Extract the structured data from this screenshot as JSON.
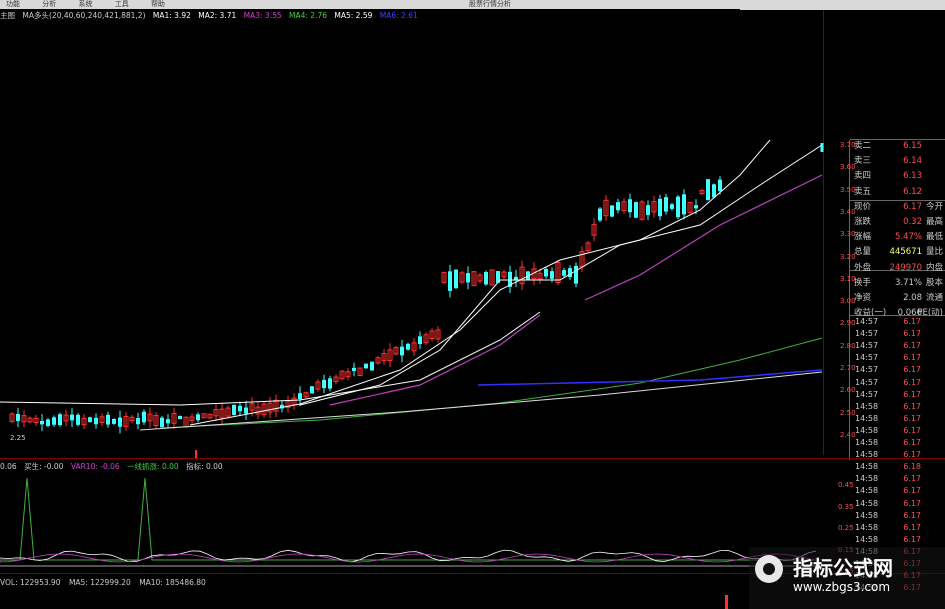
{
  "menubar": {
    "items": [
      "功能",
      "分析",
      "系统",
      "工具",
      "帮助"
    ],
    "right_title": "股票行情分析"
  },
  "indicator_line": {
    "name": "主图",
    "formula": "MA多头(20,40,60,240,421,881,2)",
    "items": [
      {
        "label": "MA1: 3.92",
        "color": "#ffffff"
      },
      {
        "label": "MA2: 3.71",
        "color": "#ffffff"
      },
      {
        "label": "MA3: 3.55",
        "color": "#d040d0"
      },
      {
        "label": "MA4: 2.76",
        "color": "#40d040"
      },
      {
        "label": "MA5: 2.59",
        "color": "#ffffff"
      },
      {
        "label": "MA6: 2.61",
        "color": "#4040ff"
      }
    ]
  },
  "price_axis": [
    "3.70",
    "3.60",
    "3.50",
    "3.40",
    "3.30",
    "3.20",
    "3.10",
    "3.00",
    "2.90",
    "2.80",
    "2.70",
    "2.60",
    "2.50",
    "2.40"
  ],
  "low_marker": "2.25",
  "quote": {
    "rows": [
      {
        "label": "卖二",
        "value": "6.15",
        "value_color": "#ff5050",
        "label2": "",
        "val2": ""
      },
      {
        "label": "卖三",
        "value": "6.14",
        "value_color": "#ff5050",
        "label2": "",
        "val2": ""
      },
      {
        "label": "卖四",
        "value": "6.13",
        "value_color": "#ff5050",
        "label2": "",
        "val2": ""
      },
      {
        "label": "卖五",
        "value": "6.12",
        "value_color": "#ff5050",
        "label2": "",
        "val2": ""
      },
      {
        "label": "现价",
        "value": "6.17",
        "value_color": "#ff5050",
        "label2": "今开",
        "val2": ""
      },
      {
        "label": "涨跌",
        "value": "0.32",
        "value_color": "#ff5050",
        "label2": "最高",
        "val2": ""
      },
      {
        "label": "涨幅",
        "value": "5.47%",
        "value_color": "#ff5050",
        "label2": "最低",
        "val2": ""
      },
      {
        "label": "总量",
        "value": "445671",
        "value_color": "#ffff66",
        "label2": "量比",
        "val2": ""
      },
      {
        "label": "外盘",
        "value": "249970",
        "value_color": "#ff5050",
        "label2": "内盘",
        "val2": ""
      },
      {
        "label": "换手",
        "value": "3.71%",
        "value_color": "#cccccc",
        "label2": "股本",
        "val2": ""
      },
      {
        "label": "净资",
        "value": "2.08",
        "value_color": "#cccccc",
        "label2": "流通",
        "val2": ""
      },
      {
        "label": "收益(一)",
        "value": "0.066",
        "value_color": "#cccccc",
        "label2": "PE(动)",
        "val2": ""
      }
    ]
  },
  "ticks": [
    {
      "time": "14:57",
      "price": "6.17"
    },
    {
      "time": "14:57",
      "price": "6.17"
    },
    {
      "time": "14:57",
      "price": "6.17"
    },
    {
      "time": "14:57",
      "price": "6.17"
    },
    {
      "time": "14:57",
      "price": "6.17"
    },
    {
      "time": "14:57",
      "price": "6.17"
    },
    {
      "time": "14:57",
      "price": "6.17"
    },
    {
      "time": "14:58",
      "price": "6.17"
    },
    {
      "time": "14:58",
      "price": "6.17"
    },
    {
      "time": "14:58",
      "price": "6.17"
    },
    {
      "time": "14:58",
      "price": "6.17"
    },
    {
      "time": "14:58",
      "price": "6.17"
    },
    {
      "time": "14:58",
      "price": "6.18"
    },
    {
      "time": "14:58",
      "price": "6.17"
    },
    {
      "time": "14:58",
      "price": "6.17"
    },
    {
      "time": "14:58",
      "price": "6.17"
    },
    {
      "time": "14:58",
      "price": "6.17"
    },
    {
      "time": "14:58",
      "price": "6.17"
    },
    {
      "time": "14:58",
      "price": "6.17"
    },
    {
      "time": "14:58",
      "price": "6.17"
    },
    {
      "time": "14:58",
      "price": "6.17"
    },
    {
      "time": "14:58",
      "price": "6.17"
    },
    {
      "time": "14:58",
      "price": "6.17"
    }
  ],
  "sub_indicator": {
    "items": [
      {
        "label": "0.06",
        "color": "#cccccc"
      },
      {
        "label": "买生: -0.00",
        "color": "#cccccc"
      },
      {
        "label": "VAR10: -0.06",
        "color": "#d040d0"
      },
      {
        "label": "一线抓涨: 0.00",
        "color": "#40d040"
      },
      {
        "label": "指标: 0.00",
        "color": "#cccccc"
      }
    ],
    "axis": [
      "0.45",
      "0.35",
      "0.25",
      "0.15",
      "0.05"
    ]
  },
  "volume_line": {
    "items": [
      "VOL: 122953.90",
      "MA5: 122999.20",
      "MA10: 185486.80"
    ]
  },
  "watermark": {
    "title": "指标公式网",
    "url": "www.zbgs3.com"
  },
  "colors": {
    "up": "#ff3030",
    "down": "#40ffff",
    "ma_white": "#ffffff",
    "ma_purple": "#c040c0",
    "ma_green": "#40b040",
    "ma_blue": "#3030ff",
    "grid_red": "#800000"
  }
}
